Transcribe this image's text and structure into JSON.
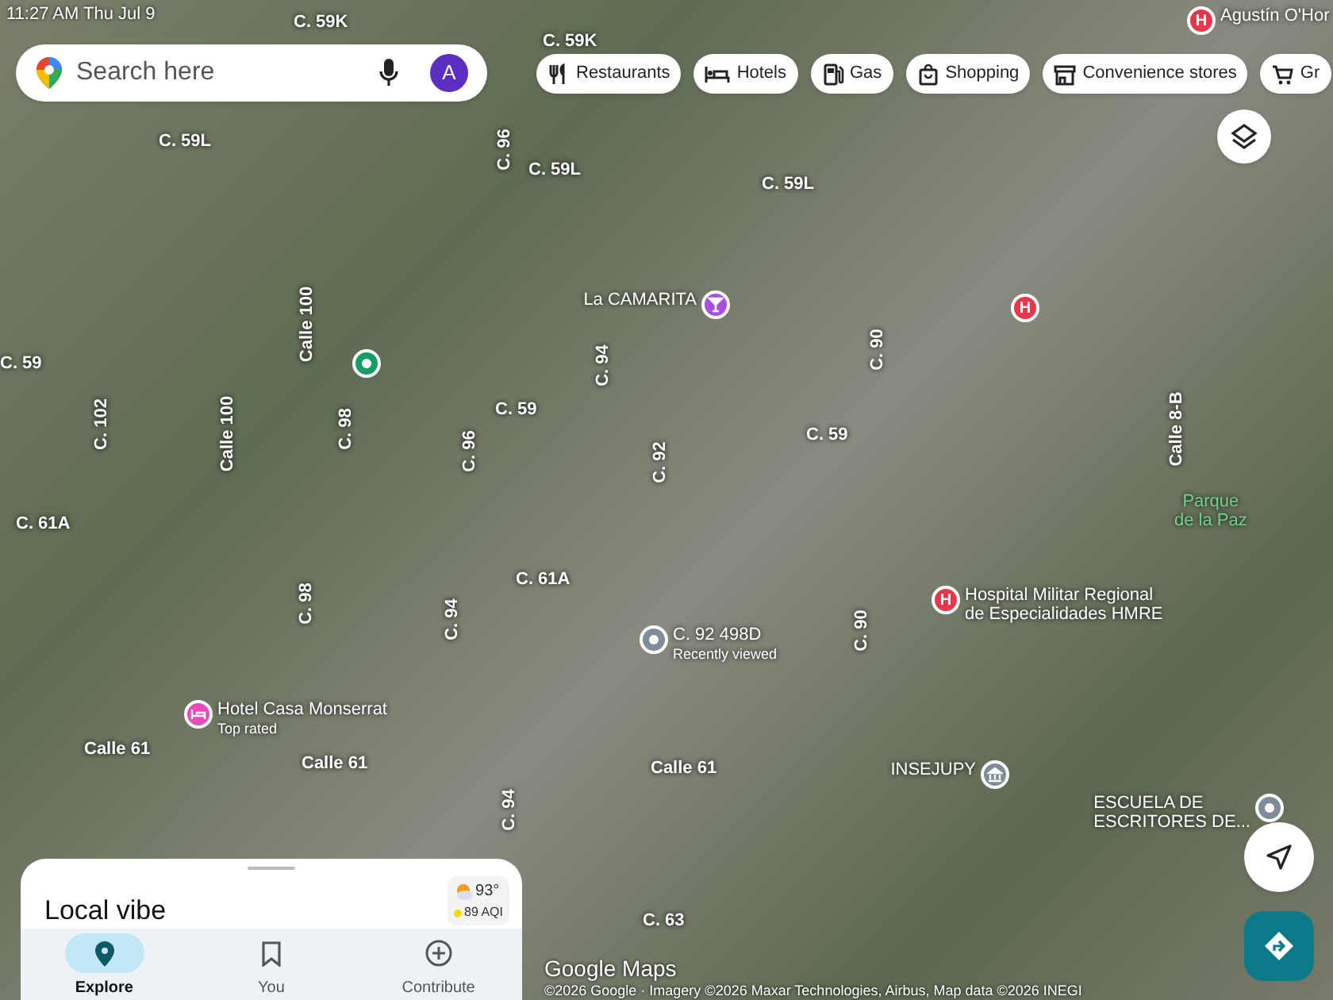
{
  "status_bar": {
    "time": "11:27 AM",
    "date": "Thu Jul 9"
  },
  "search": {
    "placeholder": "Search here",
    "avatar": "A"
  },
  "chips": [
    {
      "label": "Restaurants",
      "kind": "restaurant"
    },
    {
      "label": "Hotels",
      "kind": "hotel"
    },
    {
      "label": "Gas",
      "kind": "gas"
    },
    {
      "label": "Shopping",
      "kind": "shopping"
    },
    {
      "label": "Convenience stores",
      "kind": "store"
    },
    {
      "label": "Gr",
      "kind": "cart"
    }
  ],
  "streets": [
    {
      "label": "C. 59K",
      "kind": "horizontal"
    },
    {
      "label": "C. 59K",
      "kind": "horizontal"
    },
    {
      "label": "C. 59L",
      "kind": "horizontal"
    },
    {
      "label": "C. 96",
      "kind": "vertical"
    },
    {
      "label": "C. 59L",
      "kind": "horizontal"
    },
    {
      "label": "C. 59L",
      "kind": "horizontal"
    },
    {
      "label": "C. 59",
      "kind": "horizontal"
    },
    {
      "label": "Calle 100",
      "kind": "vertical"
    },
    {
      "label": "C. 102",
      "kind": "vertical"
    },
    {
      "label": "Calle 100",
      "kind": "vertical"
    },
    {
      "label": "C. 98",
      "kind": "vertical"
    },
    {
      "label": "C. 96",
      "kind": "vertical"
    },
    {
      "label": "C. 59",
      "kind": "horizontal"
    },
    {
      "label": "C. 94",
      "kind": "vertical"
    },
    {
      "label": "C. 92",
      "kind": "vertical"
    },
    {
      "label": "C. 59",
      "kind": "horizontal"
    },
    {
      "label": "C. 90",
      "kind": "vertical"
    },
    {
      "label": "C. 61A",
      "kind": "horizontal"
    },
    {
      "label": "C. 61A",
      "kind": "horizontal"
    },
    {
      "label": "C. 98",
      "kind": "vertical"
    },
    {
      "label": "C. 94",
      "kind": "vertical"
    },
    {
      "label": "C. 90",
      "kind": "vertical"
    },
    {
      "label": "Calle 61",
      "kind": "horizontal"
    },
    {
      "label": "Calle 61",
      "kind": "horizontal"
    },
    {
      "label": "Calle 61",
      "kind": "horizontal"
    },
    {
      "label": "C. 94",
      "kind": "vertical"
    },
    {
      "label": "C. 63",
      "kind": "horizontal"
    },
    {
      "label": "Calle 8-B",
      "kind": "vertical"
    }
  ],
  "places": [
    {
      "name": "Agustín O'Hor",
      "kind": "hospital",
      "icon": "H",
      "color": "#e8364a"
    },
    {
      "name": "La CAMARITA",
      "kind": "bar",
      "color": "#a64fe0"
    },
    {
      "kind": "hospital",
      "icon": "H",
      "color": "#e8364a"
    },
    {
      "kind": "dot",
      "color": "#129e64"
    },
    {
      "name": "Parque\nde la Paz",
      "kind": "park",
      "color": "#6fd28a"
    },
    {
      "name": "Hospital Militar Regional\nde Especialidades HMRE",
      "kind": "hospital",
      "icon": "H",
      "color": "#e8364a"
    },
    {
      "name": "C. 92 498D",
      "note": "Recently viewed",
      "kind": "recent",
      "color": "#7f8c99"
    },
    {
      "name": "Hotel Casa Monserrat",
      "note": "Top rated",
      "kind": "hotel",
      "color": "#e94bbd"
    },
    {
      "name": "INSEJUPY",
      "kind": "building",
      "color": "#7f8c99"
    },
    {
      "name": "ESCUELA DE\nESCRITORES DE...",
      "kind": "school",
      "color": "#7f8c99"
    }
  ],
  "sheet": {
    "title": "Local vibe",
    "temperature": "93°",
    "aqi": "89 AQI"
  },
  "nav": [
    {
      "label": "Explore",
      "kind": "explore",
      "selected": true
    },
    {
      "label": "You",
      "kind": "saved",
      "selected": false
    },
    {
      "label": "Contribute",
      "kind": "contribute",
      "selected": false
    }
  ],
  "logo": "Google Maps",
  "attribution": "©2026 Google · Imagery ©2026 Maxar Technologies, Airbus, Map data ©2026 INEGI"
}
